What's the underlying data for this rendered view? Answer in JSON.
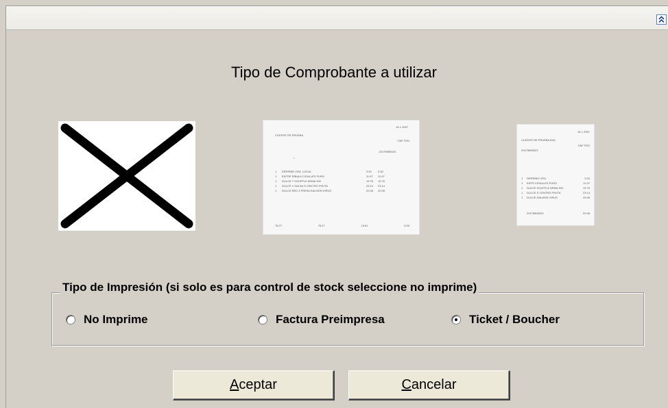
{
  "dialog": {
    "title": "Tipo de Comprobante a utilizar",
    "collapse_icon": "double-chevron-up-icon"
  },
  "images": {
    "no_print": "x-mark-icon",
    "invoice_preview": {
      "header_right": "16   1   2007",
      "client": "CLIENTE DE PRUEBA",
      "cuit_label": "CNF  FED",
      "number": "20179895023",
      "rows": [
        {
          "qty": "1",
          "desc": "DERRIBO CRA. LOCAL",
          "price": "3.00",
          "total": "3.00"
        },
        {
          "qty": "1",
          "desc": "ENTRE RIBALA CIGALLES PURO",
          "price": "11.97",
          "total": "11.97"
        },
        {
          "qty": "1",
          "desc": "DULCE Y SOUFFLE ARMA S/N",
          "price": "19.76",
          "total": "19.76"
        },
        {
          "qty": "1",
          "desc": "DULCE Y SALSA S CENTRO FRUTA",
          "price": "23.14",
          "total": "23.14"
        },
        {
          "qty": "1",
          "desc": "DULCE RED 3 FRESA SALMON VIRUS",
          "price": "20.08",
          "total": "20.08"
        }
      ],
      "footer": [
        "78.27",
        "78.27",
        "16.81",
        "0.00"
      ]
    },
    "ticket_preview": {
      "header_right": "16   1   2007",
      "client": "CLIENTE DE PRUEBA   IDIA",
      "cuit_label": "CNF  FED",
      "number": "20179895023",
      "rows": [
        {
          "qty": "1",
          "desc": "DERRIBO CRA.",
          "total": "3.00"
        },
        {
          "qty": "1",
          "desc": "ENTR CIGALLES PURO",
          "total": "11.97"
        },
        {
          "qty": "1",
          "desc": "DULCE SOUFFLE ARMA S/N",
          "total": "19.76"
        },
        {
          "qty": "1",
          "desc": "DULCE S CENTRO FRUTA",
          "total": "23.14"
        },
        {
          "qty": "1",
          "desc": "DULCE SALMON VIRUS",
          "total": "20.08"
        }
      ],
      "footer_left": "20179895023",
      "footer_right": "20.08"
    }
  },
  "print_type": {
    "legend": "Tipo de Impresión (si solo es para control de stock seleccione no imprime)",
    "options": [
      {
        "label": "No Imprime",
        "selected": false
      },
      {
        "label": "Factura Preimpresa",
        "selected": false
      },
      {
        "label": "Ticket / Boucher",
        "selected": true
      }
    ]
  },
  "buttons": {
    "accept": {
      "label": "Aceptar",
      "mnemonic": "A",
      "rest": "ceptar"
    },
    "cancel": {
      "label": "Cancelar",
      "mnemonic": "C",
      "rest": "ancelar"
    }
  }
}
